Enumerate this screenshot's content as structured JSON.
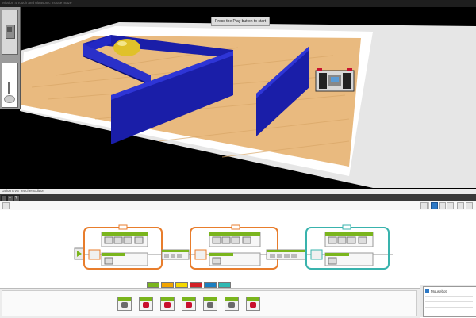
{
  "simulator": {
    "window_title": "Mission 4 Touch and ultrasonic mouse maze",
    "hint": "Press the Play button to start"
  },
  "editor": {
    "window_title": "cation EV3 Teacher Edition",
    "tabs": [
      "+",
      "?"
    ],
    "palette_colors": [
      "#7ab51d",
      "#f2a400",
      "#f5d800",
      "#d21f26",
      "#1a7fc2",
      "#2fb9b3"
    ],
    "hardware_page": {
      "label": "Mousebot"
    }
  },
  "colors": {
    "maze_wall": "#1a1ea8",
    "floor": "#e8b878",
    "sequence_wire": "#e87d2c",
    "loop_teal": "#39b3ad"
  },
  "icons": [
    "camera-icon",
    "robot-icon",
    "play-icon",
    "move-steering-icon",
    "sound-icon",
    "wait-icon",
    "loop-icon",
    "switch-icon",
    "brick-status-light-icon",
    "save-icon",
    "download-icon",
    "zoom-icon"
  ]
}
